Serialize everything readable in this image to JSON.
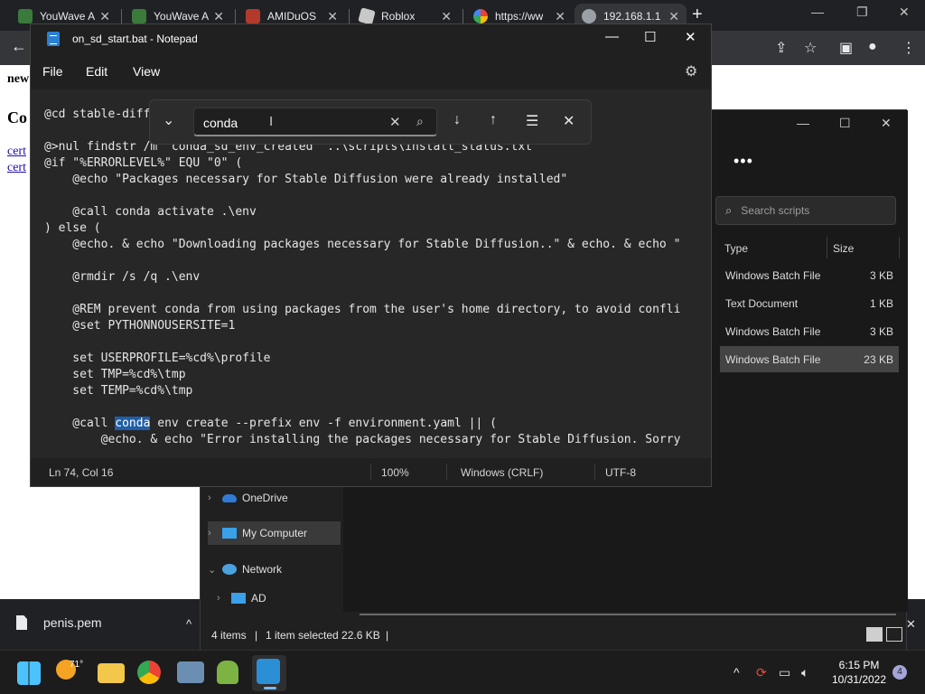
{
  "browser": {
    "tabs": [
      {
        "title": "YouWave A",
        "icon_color": "#3a7a3a"
      },
      {
        "title": "YouWave A",
        "icon_color": "#3a7a3a"
      },
      {
        "title": "AMIDuOS",
        "icon_color": "#b13a2a"
      },
      {
        "title": "Roblox",
        "icon_color": "#c8c8c8"
      },
      {
        "title": "https://ww",
        "icon_color": "#4285f4"
      },
      {
        "title": "192.168.1.1",
        "icon_color": "#9aa0a6"
      }
    ],
    "new_tab": "+",
    "window_controls": [
      "—",
      "❐",
      "✕"
    ],
    "toolbar_icons": [
      "arrow-left-icon",
      "share-icon",
      "star-icon",
      "sidebar-icon",
      "profile-icon",
      "menu-icon"
    ]
  },
  "page": {
    "fragment_1": "new",
    "fragment_2": "Co",
    "link_1": "cert",
    "link_2": "cert"
  },
  "download": {
    "filename": "penis.pem",
    "chevron": "^"
  },
  "explorer": {
    "search_placeholder": "Search scripts",
    "more": "•••",
    "columns": {
      "type": "Type",
      "size": "Size"
    },
    "rows": [
      {
        "type": "Windows Batch File",
        "size": "3 KB",
        "selected": false
      },
      {
        "type": "Text Document",
        "size": "1 KB",
        "selected": false
      },
      {
        "type": "Windows Batch File",
        "size": "3 KB",
        "selected": false
      },
      {
        "type": "Windows Batch File",
        "size": "23 KB",
        "selected": true
      }
    ],
    "nav": {
      "onedrive": "OneDrive",
      "my_computer": "My Computer",
      "network": "Network",
      "ad": "AD"
    },
    "status": {
      "count": "4 items",
      "selected": "1 item selected  22.6 KB"
    }
  },
  "notepad": {
    "title": "on_sd_start.bat - Notepad",
    "menu": {
      "file": "File",
      "edit": "Edit",
      "view": "View"
    },
    "lines": [
      "@cd stable-diff",
      "",
      "@>nul findstr /m \"conda_sd_env_created\" ..\\scripts\\install_status.txt",
      "@if \"%ERRORLEVEL%\" EQU \"0\" (",
      "    @echo \"Packages necessary for Stable Diffusion were already installed\"",
      "",
      "    @call conda activate .\\env",
      ") else (",
      "    @echo. & echo \"Downloading packages necessary for Stable Diffusion..\" & echo. & echo \"",
      "",
      "    @rmdir /s /q .\\env",
      "",
      "    @REM prevent conda from using packages from the user's home directory, to avoid confli",
      "    @set PYTHONNOUSERSITE=1",
      "",
      "    set USERPROFILE=%cd%\\profile",
      "    set TMP=%cd%\\tmp",
      "    set TEMP=%cd%\\tmp",
      "",
      "    @call ",
      "        @echo. & echo \"Error installing the packages necessary for Stable Diffusion. Sorry"
    ],
    "highlight_line": {
      "before": "    @call ",
      "match": "conda",
      "after": " env create --prefix env -f environment.yaml || ("
    },
    "status": {
      "position": "Ln 74, Col 16",
      "zoom": "100%",
      "line_ending": "Windows (CRLF)",
      "encoding": "UTF-8"
    }
  },
  "find": {
    "value": "conda",
    "caret": "I"
  },
  "taskbar": {
    "weather_temp": "71°",
    "time": "6:15 PM",
    "date": "10/31/2022",
    "notifications": "4"
  },
  "colors": {
    "selection": "#1f5fa8",
    "notepad_bg": "#272727",
    "taskbar_bg": "#1c1c1c"
  }
}
